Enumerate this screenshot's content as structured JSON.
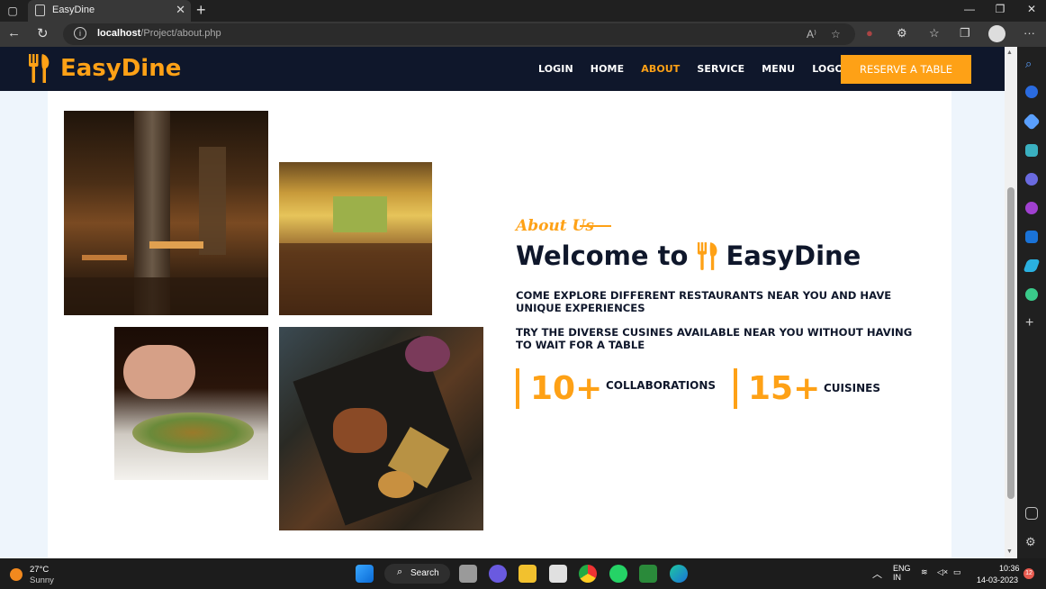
{
  "browser": {
    "tab_title": "EasyDine",
    "url_host": "localhost",
    "url_path": "/Project/about.php",
    "window_controls": {
      "minimize": "—",
      "restore": "❐",
      "close": "✕"
    },
    "read_aloud": "A⁾",
    "more_menu": "···"
  },
  "site": {
    "brand": "EasyDine",
    "nav": [
      "LOGIN",
      "HOME",
      "ABOUT",
      "SERVICE",
      "MENU",
      "LOGOUT"
    ],
    "active_nav": "ABOUT",
    "cta": "RESERVE A TABLE",
    "accent_color": "#fea116",
    "dark_color": "#0f172b"
  },
  "about": {
    "label": "About Us",
    "heading_prefix": "Welcome to",
    "heading_brand": "EasyDine",
    "para1": "COME EXPLORE DIFFERENT RESTAURANTS NEAR YOU AND HAVE UNIQUE EXPERIENCES",
    "para2": "TRY THE DIVERSE CUSINES AVAILABLE NEAR YOU WITHOUT HAVING TO WAIT FOR A TABLE",
    "stats": [
      {
        "number": "10+",
        "label": "COLLABORATIONS"
      },
      {
        "number": "15+",
        "label": "CUISINES"
      }
    ]
  },
  "taskbar": {
    "weather_temp": "27°C",
    "weather_cond": "Sunny",
    "search_label": "Search",
    "lang_line1": "ENG",
    "lang_line2": "IN",
    "time": "10:36",
    "date": "14-03-2023",
    "notifications": "12"
  }
}
